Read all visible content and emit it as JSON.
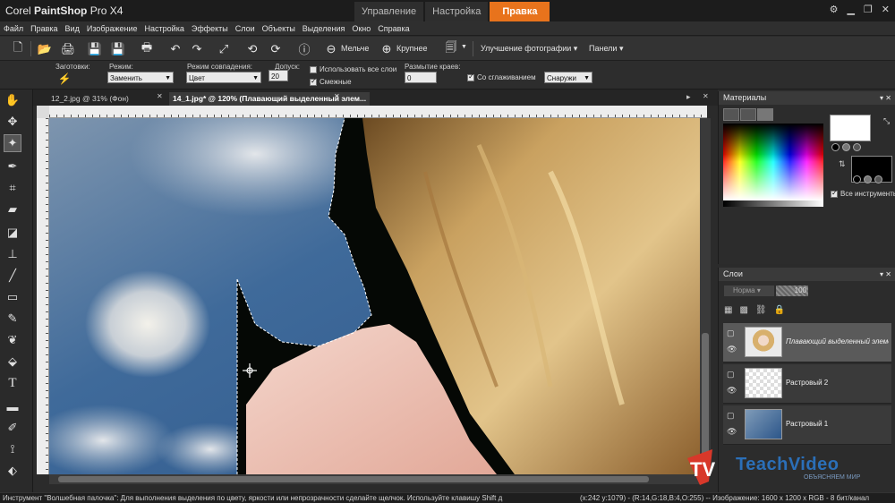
{
  "app": {
    "brand": "Corel",
    "product": "PaintShop",
    "version": "Pro X4"
  },
  "workspace_tabs": [
    {
      "label": "Управление",
      "active": false
    },
    {
      "label": "Настройка",
      "active": false
    },
    {
      "label": "Правка",
      "active": true
    }
  ],
  "menu": [
    "Файл",
    "Правка",
    "Вид",
    "Изображение",
    "Настройка",
    "Эффекты",
    "Слои",
    "Объекты",
    "Выделения",
    "Окно",
    "Справка"
  ],
  "toolbar": {
    "zoom_out_label": "Мельче",
    "zoom_in_label": "Крупнее",
    "enhance_label": "Улучшение фотографии",
    "panels_label": "Панели"
  },
  "tool_options": {
    "presets_label": "Заготовки:",
    "mode_label": "Режим:",
    "mode_value": "Заменить",
    "match_mode_label": "Режим совпадения:",
    "match_mode_value": "Цвет",
    "tolerance_label": "Допуск:",
    "tolerance_value": "20",
    "use_all_layers_label": "Использовать все слои",
    "use_all_layers_checked": false,
    "contiguous_label": "Смежные",
    "contiguous_checked": true,
    "feather_label": "Размытие краев:",
    "feather_value": "0",
    "antialias_label": "Со сглаживанием",
    "antialias_checked": true,
    "antialias_mode_value": "Снаружи"
  },
  "documents": [
    {
      "label": "12_2.jpg @ 31% (Фон)",
      "active": false
    },
    {
      "label": "14_1.jpg* @ 120% (Плавающий выделенный элем...",
      "active": true
    }
  ],
  "materials": {
    "title": "Материалы",
    "all_tools_label": "Все инструменты",
    "all_tools_checked": true,
    "foreground": "#ffffff",
    "background": "#000000"
  },
  "layers": {
    "title": "Слои",
    "blend_mode": "Норма",
    "opacity": "100",
    "items": [
      {
        "name": "Плавающий выделенный элемент",
        "selected": true
      },
      {
        "name": "Растровый 2",
        "selected": false
      },
      {
        "name": "Растровый 1",
        "selected": false
      }
    ]
  },
  "status": {
    "hint": "Инструмент \"Волшебная палочка\": Для выполнения выделения по цвету, яркости или непрозрачности сделайте щелчок. Используйте клавишу Shift д",
    "info": "(x:242 y:1079) - (R:14,G:18,B:4,O:255) -- Изображение: 1600 x 1200 x RGB - 8 бит/канал"
  },
  "watermark": {
    "brand": "TeachVideo",
    "slogan": "ОБЪЯСНЯЕМ МИР"
  },
  "colors": {
    "accent": "#e8731c",
    "panel": "#2c2c2c",
    "titlebar": "#1c1c1c"
  }
}
